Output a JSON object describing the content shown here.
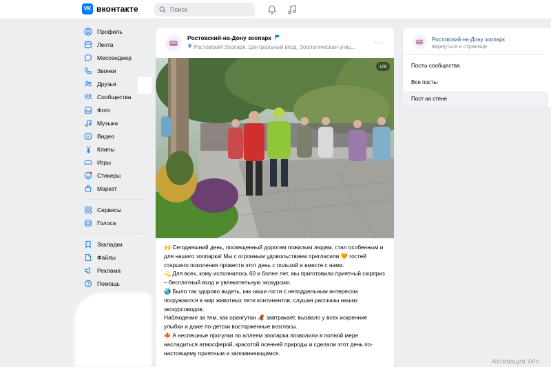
{
  "header": {
    "logo_text": "вконтакте",
    "logo_mark": "VK",
    "search_placeholder": "Поиск"
  },
  "nav": {
    "items": [
      {
        "label": "Профиль",
        "icon": "profile-icon"
      },
      {
        "label": "Лента",
        "icon": "feed-icon"
      },
      {
        "label": "Мессенджер",
        "icon": "messenger-icon"
      },
      {
        "label": "Звонки",
        "icon": "calls-icon"
      },
      {
        "label": "Друзья",
        "icon": "friends-icon"
      },
      {
        "label": "Сообщества",
        "icon": "communities-icon"
      },
      {
        "label": "Фото",
        "icon": "photo-icon"
      },
      {
        "label": "Музыка",
        "icon": "music-icon"
      },
      {
        "label": "Видео",
        "icon": "video-icon"
      },
      {
        "label": "Клипы",
        "icon": "clips-icon"
      },
      {
        "label": "Игры",
        "icon": "games-icon"
      },
      {
        "label": "Стикеры",
        "icon": "stickers-icon"
      },
      {
        "label": "Маркет",
        "icon": "market-icon"
      }
    ],
    "items2": [
      {
        "label": "Сервисы",
        "icon": "services-icon"
      },
      {
        "label": "Голоса",
        "icon": "votes-icon"
      }
    ],
    "items3": [
      {
        "label": "Закладки",
        "icon": "bookmarks-icon"
      },
      {
        "label": "Файлы",
        "icon": "files-icon"
      },
      {
        "label": "Реклама",
        "icon": "ads-icon"
      },
      {
        "label": "Помощь",
        "icon": "help-icon"
      }
    ]
  },
  "post": {
    "author": "Ростовский-на-Дону зоопарк",
    "location": "Ростовский Зоопарк. Центральный вход, Зоологическая улиц...",
    "photo_counter": "1/8",
    "paragraphs": [
      {
        "emoji": "🙌",
        "text": "Сегодняшний день, посвященный дорогим пожилым людям, стал особенным и для нашего зоопарка! Мы с огромным удовольствием пригласили 🧡 гостей старшего поколения провести этот день с пользой и вместе с нами."
      },
      {
        "emoji": "💫",
        "text": "Для всех, кому исполнилось 60 и более лет, мы приготовили приятный сюрприз – бесплатный вход и увлекательную экскурсию."
      },
      {
        "emoji": "🌏",
        "text": "Было так здорово видеть, как наши гости с неподдельным интересом погружаются в мир животных пяти континентов, слушая рассказы наших экскурсоводов."
      },
      {
        "emoji": "",
        "text": "Наблюдение за тем, как орангутан 🦧 завтракает, вызвало у всех искренние улыбки и даже по-детски восторженные возгласы."
      },
      {
        "emoji": "🍁",
        "text": "А неспешные прогулки по аллеям зоопарка позволили в полной мере насладиться атмосферой, красотой осенней природы и сделали этот день по-настоящему приятным и запоминающимся."
      }
    ]
  },
  "right": {
    "group_name": "Ростовский-на-Дону зоопарк",
    "back_label": "вернуться к странице",
    "menu": [
      "Посты сообщества",
      "Все посты",
      "Пост на стене"
    ],
    "active_index": 2
  },
  "watermark": "Активация Win",
  "colors": {
    "accent": "#0077ff",
    "link": "#2a5885",
    "muted": "#818c99",
    "bg": "#edeef0"
  }
}
